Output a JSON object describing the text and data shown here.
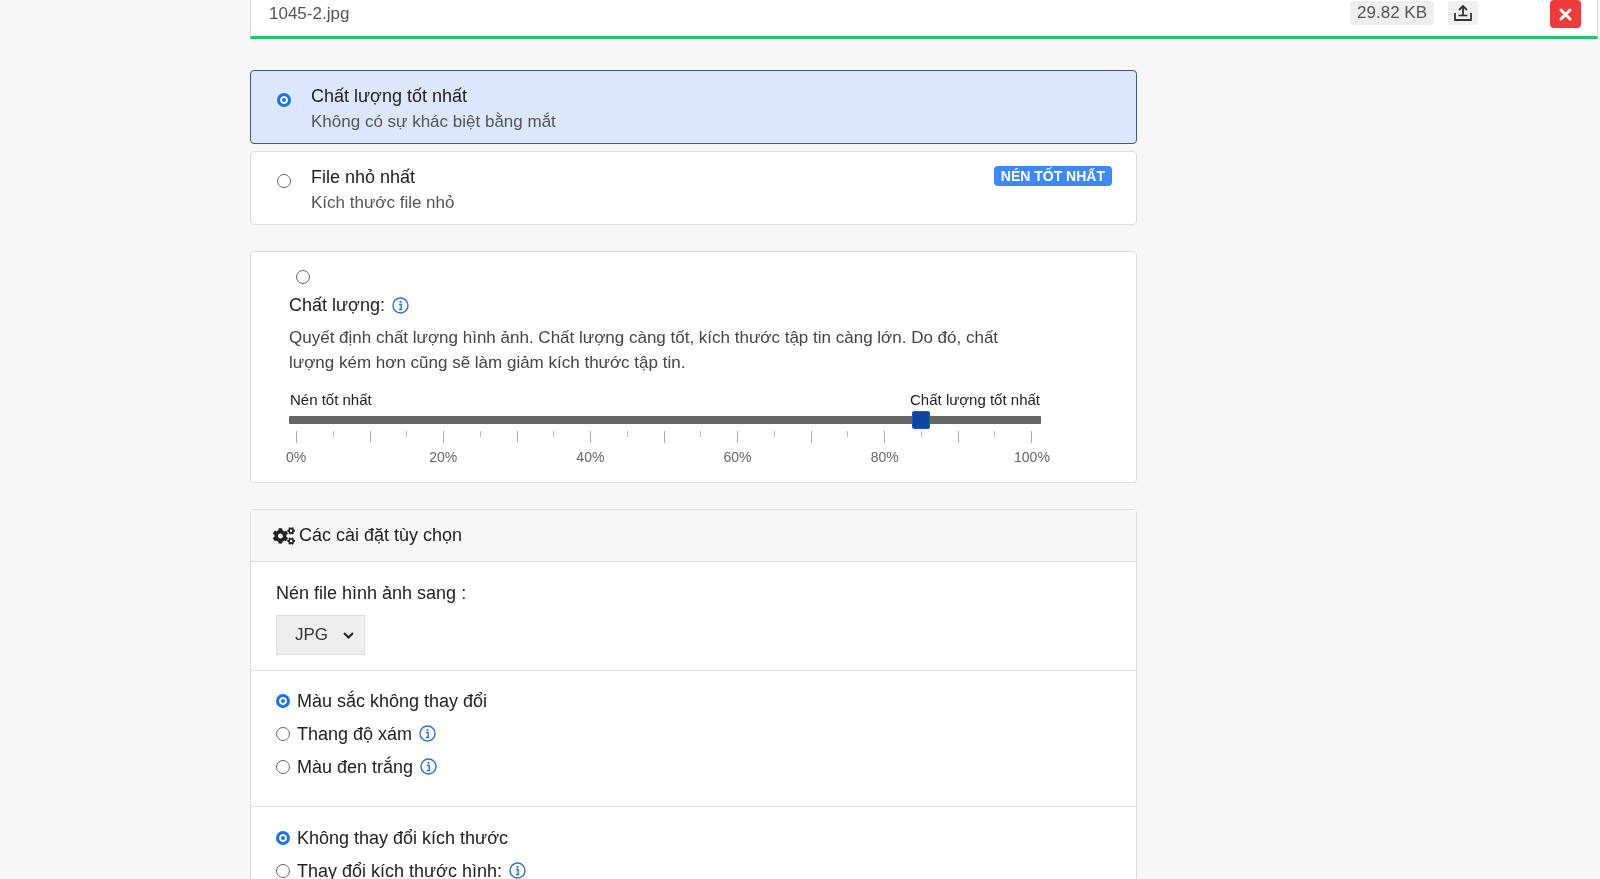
{
  "file": {
    "name": "1045-2.jpg",
    "size": "29.82 KB",
    "progress": {
      "level": 1
    }
  },
  "quality_presets": [
    {
      "title": "Chất lượng tốt nhất",
      "subtitle": "Không có sự khác biệt bằng mắt",
      "selected": true
    },
    {
      "title": "File nhỏ nhất",
      "subtitle": "Kích thước file nhỏ",
      "badge": "NÉN TỐT NHẤT",
      "selected": false
    }
  ],
  "custom_quality": {
    "selected": false,
    "label": "Chất lượng:",
    "description": "Quyết định chất lượng hình ảnh. Chất lượng càng tốt, kích thước tập tin càng lớn. Do đó, chất lượng kém hơn cũng sẽ làm giảm kích thước tập tin.",
    "min_label": "Nén tốt nhất",
    "max_label": "Chất lượng tốt nhất",
    "level": 0.85,
    "tick_labels": [
      "0%",
      "20%",
      "40%",
      "60%",
      "80%",
      "100%"
    ]
  },
  "settings": {
    "title": "Các cài đặt tùy chọn",
    "format": {
      "label": "Nén file hình ảnh sang :",
      "value": "JPG"
    },
    "color_modes": [
      {
        "label": "Màu sắc không thay đổi",
        "selected": true,
        "info": false
      },
      {
        "label": "Thang độ xám",
        "selected": false,
        "info": true
      },
      {
        "label": "Màu đen trắng",
        "selected": false,
        "info": true
      }
    ],
    "resize_modes": [
      {
        "label": "Không thay đổi kích thước",
        "selected": true,
        "info": false
      },
      {
        "label": "Thay đổi kích thước hình:",
        "selected": false,
        "info": true
      }
    ]
  }
}
